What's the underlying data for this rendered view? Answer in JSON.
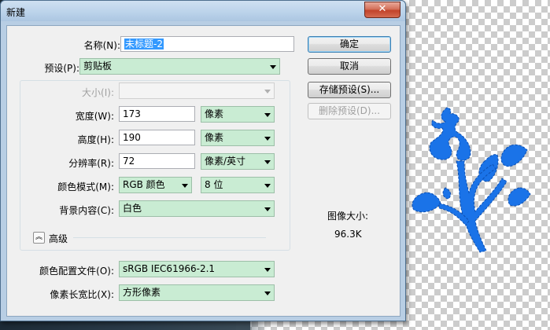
{
  "dialog": {
    "title": "新建",
    "close_glyph": "✕",
    "colors": {
      "dropdown_bg": "#c9ecd3",
      "selection": "#3399ff",
      "artwork": "#1a73e8"
    }
  },
  "form": {
    "name_label": "名称(N):",
    "name_value": "未标题-2",
    "preset_label": "预设(P):",
    "preset_value": "剪贴板",
    "size_label": "大小(I):",
    "size_value": "",
    "width_label": "宽度(W):",
    "width_value": "173",
    "width_unit": "像素",
    "height_label": "高度(H):",
    "height_value": "190",
    "height_unit": "像素",
    "resolution_label": "分辨率(R):",
    "resolution_value": "72",
    "resolution_unit": "像素/英寸",
    "color_mode_label": "颜色模式(M):",
    "color_mode_value": "RGB 颜色",
    "bit_depth_value": "8 位",
    "background_label": "背景内容(C):",
    "background_value": "白色",
    "advanced_label": "高级",
    "advanced_icon": "chevron-up-icon",
    "color_profile_label": "颜色配置文件(O):",
    "color_profile_value": "sRGB IEC61966-2.1",
    "pixel_aspect_label": "像素长宽比(X):",
    "pixel_aspect_value": "方形像素"
  },
  "buttons": {
    "ok": "确定",
    "cancel": "取消",
    "save_preset": "存储预设(S)...",
    "delete_preset": "删除预设(D)..."
  },
  "info": {
    "image_size_label": "图像大小:",
    "image_size_value": "96.3K"
  }
}
